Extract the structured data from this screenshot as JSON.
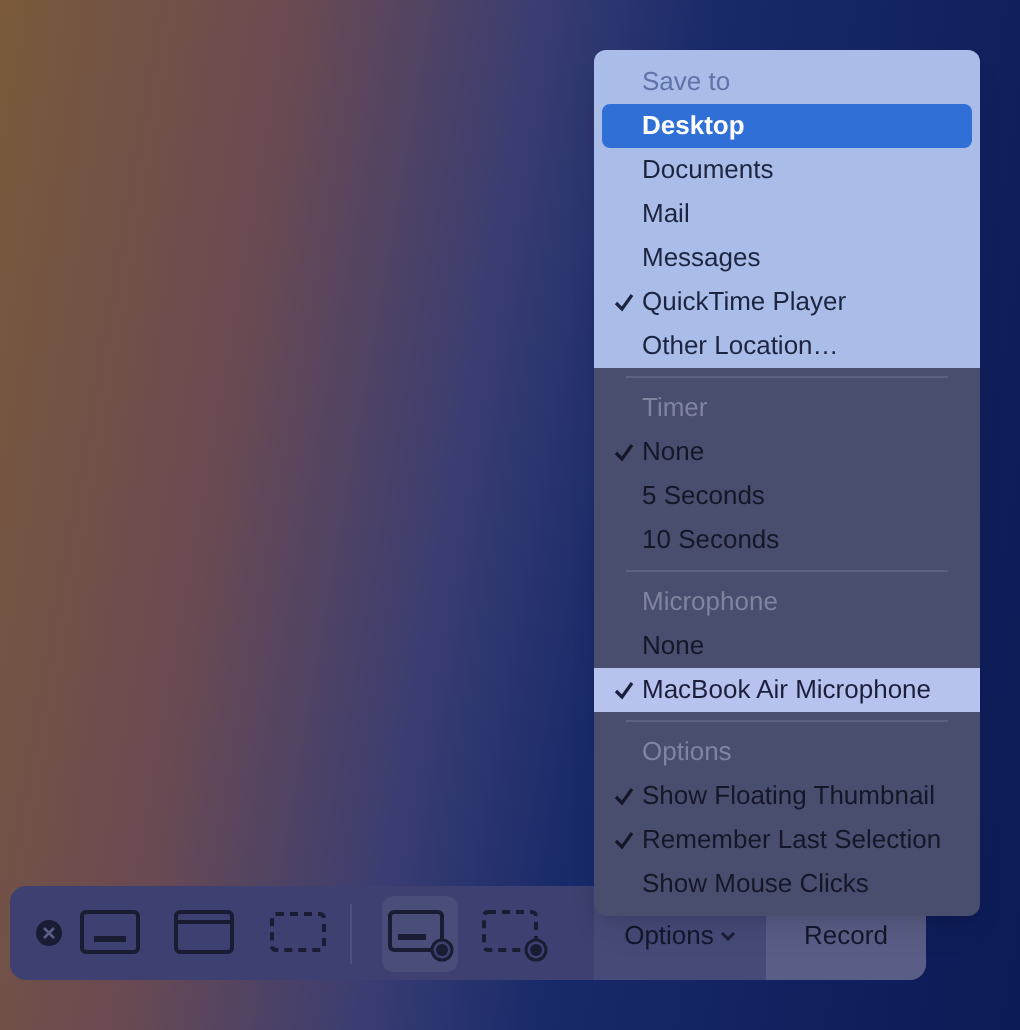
{
  "menu": {
    "sections": [
      {
        "title": "Save to",
        "highlighted": true,
        "items": [
          {
            "label": "Desktop",
            "checked": false,
            "selected": true,
            "highlighted": false
          },
          {
            "label": "Documents",
            "checked": false,
            "selected": false,
            "highlighted": false
          },
          {
            "label": "Mail",
            "checked": false,
            "selected": false,
            "highlighted": false
          },
          {
            "label": "Messages",
            "checked": false,
            "selected": false,
            "highlighted": false
          },
          {
            "label": "QuickTime Player",
            "checked": true,
            "selected": false,
            "highlighted": false
          },
          {
            "label": "Other Location…",
            "checked": false,
            "selected": false,
            "highlighted": false
          }
        ]
      },
      {
        "title": "Timer",
        "highlighted": false,
        "items": [
          {
            "label": "None",
            "checked": true,
            "selected": false,
            "highlighted": false
          },
          {
            "label": "5 Seconds",
            "checked": false,
            "selected": false,
            "highlighted": false
          },
          {
            "label": "10 Seconds",
            "checked": false,
            "selected": false,
            "highlighted": false
          }
        ]
      },
      {
        "title": "Microphone",
        "highlighted": false,
        "items": [
          {
            "label": "None",
            "checked": false,
            "selected": false,
            "highlighted": false
          },
          {
            "label": "MacBook Air Microphone",
            "checked": true,
            "selected": false,
            "highlighted": true
          }
        ]
      },
      {
        "title": "Options",
        "highlighted": false,
        "items": [
          {
            "label": "Show Floating Thumbnail",
            "checked": true,
            "selected": false,
            "highlighted": false
          },
          {
            "label": "Remember Last Selection",
            "checked": true,
            "selected": false,
            "highlighted": false
          },
          {
            "label": "Show Mouse Clicks",
            "checked": false,
            "selected": false,
            "highlighted": false
          }
        ]
      }
    ]
  },
  "toolbar": {
    "tools": [
      {
        "kind": "screen",
        "selected": false
      },
      {
        "kind": "window",
        "selected": false
      },
      {
        "kind": "selection",
        "selected": false
      },
      {
        "kind": "record-screen",
        "selected": true
      },
      {
        "kind": "record-selection",
        "selected": false
      }
    ],
    "options_label": "Options",
    "record_label": "Record"
  }
}
